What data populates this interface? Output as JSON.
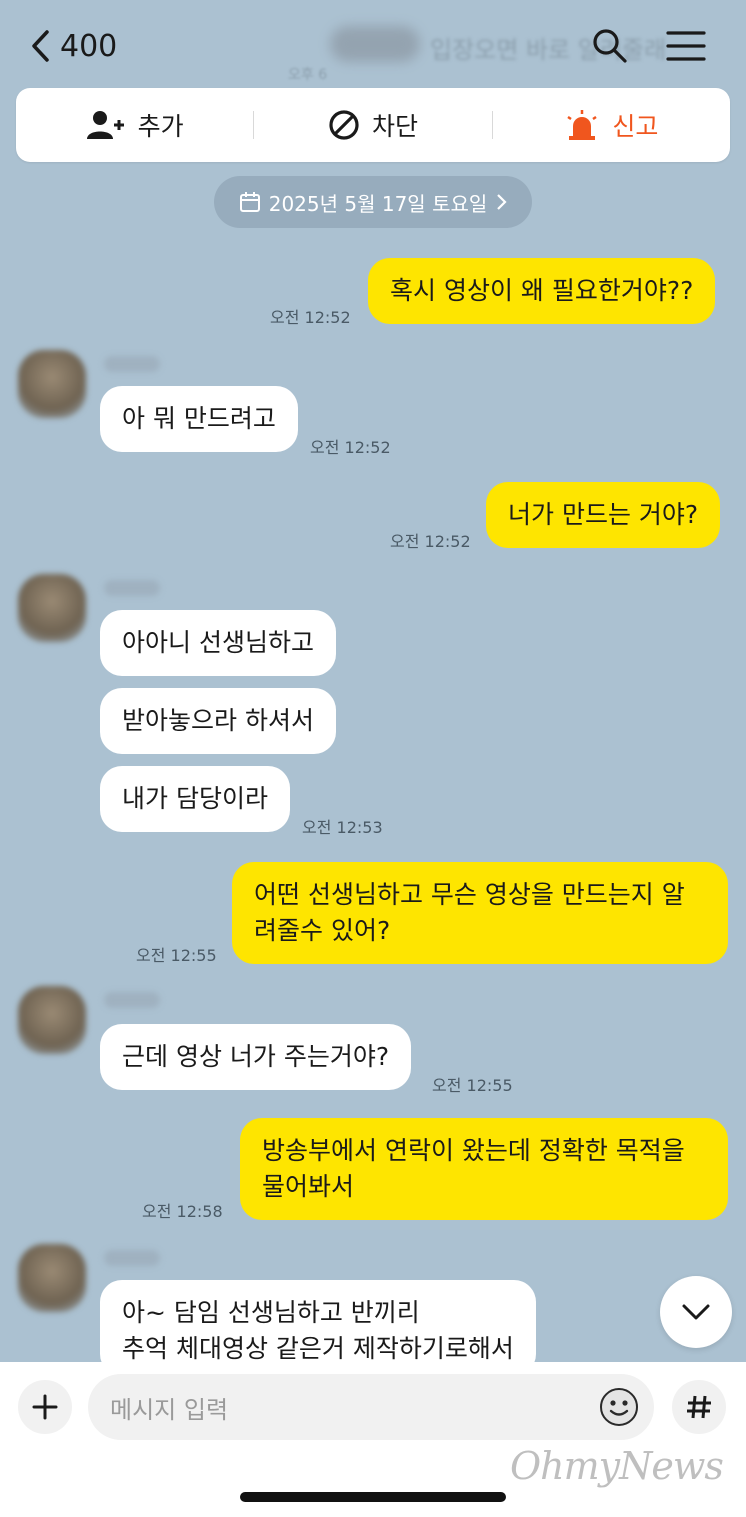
{
  "header": {
    "back_count": "400",
    "ghost_text": "입장오면 바로 알려줄래",
    "ghost_time": "오후 6"
  },
  "actions": {
    "add_label": "추가",
    "block_label": "차단",
    "report_label": "신고"
  },
  "date_divider": "2025년 5월 17일 토요일",
  "messages": [
    {
      "text": "혹시 영상이 왜 필요한거야??",
      "time": "오전 12:52"
    },
    {
      "text": "아 뭐 만드려고",
      "time": "오전 12:52"
    },
    {
      "text": "너가 만드는 거야?",
      "time": "오전 12:52"
    },
    {
      "text": "아아니 선생님하고"
    },
    {
      "text": "받아놓으라 하셔서"
    },
    {
      "text": "내가 담당이라",
      "time": "오전 12:53"
    },
    {
      "line1": "어떤 선생님하고 무슨 영상을 만드는지 알",
      "line2": "려줄수 있어?",
      "time": "오전 12:55"
    },
    {
      "text": "근데 영상 너가 주는거야?",
      "time": "오전 12:55"
    },
    {
      "line1": "방송부에서 연락이 왔는데 정확한 목적을",
      "line2": "물어봐서",
      "time": "오전 12:58"
    },
    {
      "line1": "아~ 담임 선생님하고 반끼리",
      "line2": "추억 체대영상 같은거 제작하기로해서"
    }
  ],
  "input": {
    "placeholder": "메시지 입력"
  },
  "watermark": "OhmyNews",
  "colors": {
    "background": "#abc1d1",
    "outgoing_bubble": "#fee500",
    "incoming_bubble": "#ffffff",
    "report_accent": "#f0561e"
  }
}
